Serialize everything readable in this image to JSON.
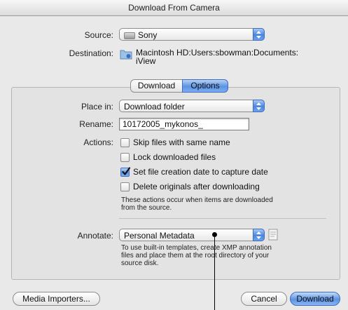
{
  "window": {
    "title": "Download From Camera"
  },
  "source": {
    "label": "Source:",
    "value": "Sony"
  },
  "destination": {
    "label": "Destination:",
    "path_line1": "Macintosh HD:Users:sbowman:Documents:",
    "path_line2": "iView"
  },
  "tabs": {
    "download": "Download",
    "options": "Options",
    "selected": "Options"
  },
  "place_in": {
    "label": "Place in:",
    "value": "Download folder"
  },
  "rename": {
    "label": "Rename:",
    "value": "10172005_mykonos_"
  },
  "actions": {
    "label": "Actions:",
    "items": [
      {
        "label": "Skip files with same name",
        "checked": false
      },
      {
        "label": "Lock downloaded files",
        "checked": false
      },
      {
        "label": "Set file creation date to capture date",
        "checked": true
      },
      {
        "label": "Delete originals after downloading",
        "checked": false
      }
    ],
    "note_line1": "These actions occur when items are downloaded",
    "note_line2": "from the source."
  },
  "annotate": {
    "label": "Annotate:",
    "value": "Personal Metadata",
    "note_line1": "To use built-in templates, create XMP annotation",
    "note_line2": "files and place them at the root directory of your",
    "note_line3": "source disk."
  },
  "buttons": {
    "media_importers": "Media Importers...",
    "cancel": "Cancel",
    "download": "Download"
  },
  "colors": {
    "accent": "#5b92e2",
    "window_bg": "#e9e9e9",
    "panel_bg": "#e3e3e3"
  }
}
